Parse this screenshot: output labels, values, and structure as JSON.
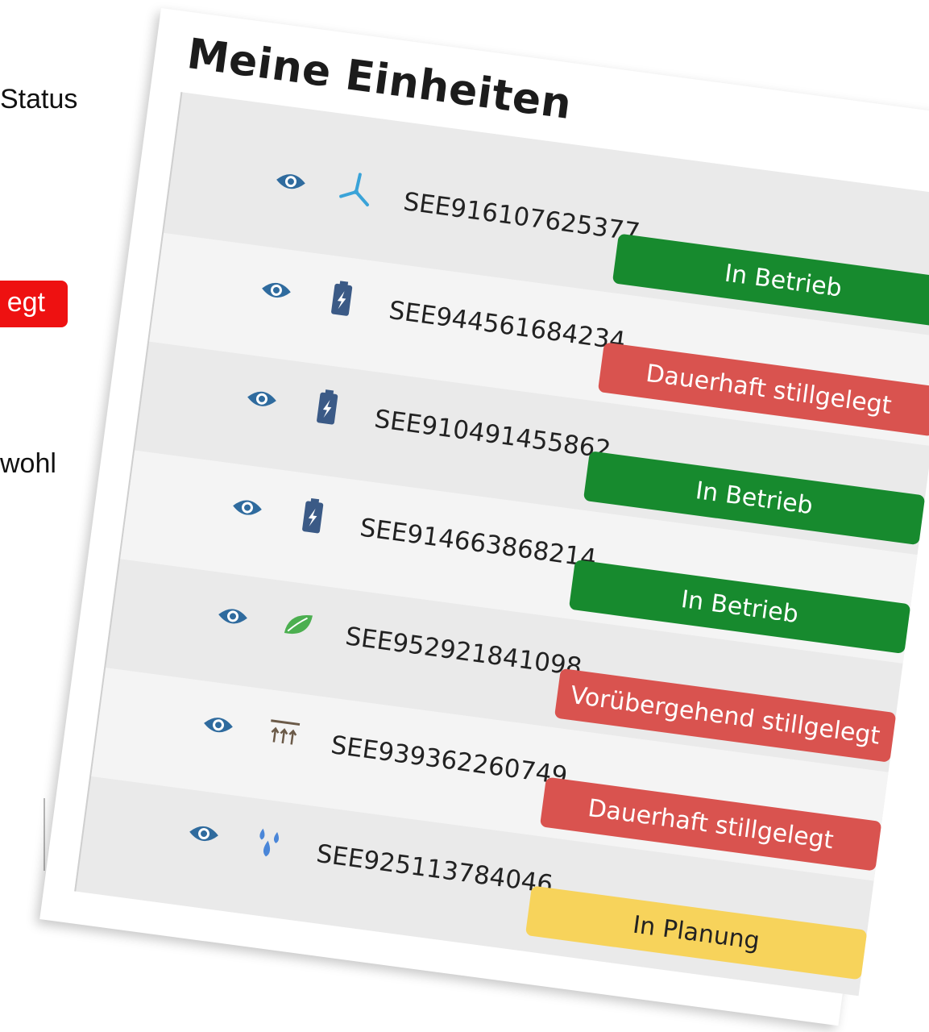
{
  "side_text": {
    "line1": "Status",
    "badge": "egt",
    "line3": "wohl"
  },
  "panel": {
    "title": "Meine Einheiten"
  },
  "colors": {
    "green": "#178a2e",
    "red": "#d9534f",
    "yellow": "#f7d35b",
    "eye_blue": "#2f6b9e",
    "battery": "#3b5a86",
    "wind": "#3aa3d8",
    "leaf": "#4caf50",
    "heat": "#6b5a48",
    "water": "#4a86d8"
  },
  "units": [
    {
      "id": "SEE916107625377",
      "icon": "wind-turbine-icon",
      "status": "In Betrieb",
      "status_color": "#178a2e",
      "status_text_color": "#ffffff"
    },
    {
      "id": "SEE944561684234",
      "icon": "battery-icon",
      "status": "Dauerhaft stillgelegt",
      "status_color": "#d9534f",
      "status_text_color": "#ffffff"
    },
    {
      "id": "SEE910491455862",
      "icon": "battery-icon",
      "status": "In Betrieb",
      "status_color": "#178a2e",
      "status_text_color": "#ffffff"
    },
    {
      "id": "SEE914663868214",
      "icon": "battery-icon",
      "status": "In Betrieb",
      "status_color": "#178a2e",
      "status_text_color": "#ffffff"
    },
    {
      "id": "SEE952921841098",
      "icon": "leaf-icon",
      "status": "Vorübergehend stillgelegt",
      "status_color": "#d9534f",
      "status_text_color": "#ffffff"
    },
    {
      "id": "SEE939362260749",
      "icon": "geothermal-icon",
      "status": "Dauerhaft stillgelegt",
      "status_color": "#d9534f",
      "status_text_color": "#ffffff"
    },
    {
      "id": "SEE925113784046",
      "icon": "water-drops-icon",
      "status": "In Planung",
      "status_color": "#f7d35b",
      "status_text_color": "#222222"
    }
  ]
}
